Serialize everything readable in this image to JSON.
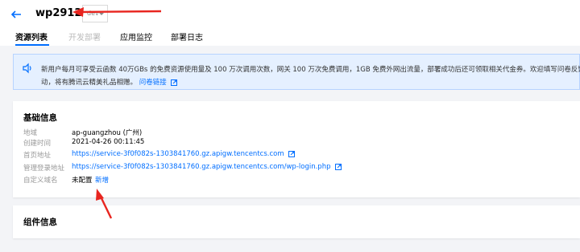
{
  "app": {
    "title": "wp29123",
    "env": "dev"
  },
  "tabs": [
    {
      "label": "资源列表",
      "state": "active"
    },
    {
      "label": "开发部署",
      "state": "disabled"
    },
    {
      "label": "应用监控",
      "state": "normal"
    },
    {
      "label": "部署日志",
      "state": "normal"
    }
  ],
  "notice": {
    "line1": "新用户每月可享受云函数 40万GBs 的免费资源使用量及 100 万次调用次数，网关 100 万次免费调用，1GB 免费外网出流量，部署成功后还可领取相关代金券。欢迎填写问卷反馈，并进入 QQ 讨",
    "line2": "动，将有腾讯云精美礼品相赠。",
    "link": "问卷链接"
  },
  "basic_info": {
    "title": "基础信息",
    "rows": [
      {
        "label": "地域",
        "value": "ap-guangzhou (广州)"
      },
      {
        "label": "创建时间",
        "value": "2021-04-26 00:11:45"
      },
      {
        "label": "首页地址",
        "value": "https://service-3f0f082s-1303841760.gz.apigw.tencentcs.com"
      },
      {
        "label": "管理登录地址",
        "value": "https://service-3f0f082s-1303841760.gz.apigw.tencentcs.com/wp-login.php"
      },
      {
        "label": "自定义域名",
        "value": "未配置",
        "action": "新增"
      }
    ]
  },
  "component_info": {
    "title": "组件信息"
  },
  "colors": {
    "accent": "#006eff",
    "annotation": "#e8251f"
  },
  "icons": [
    "back-arrow-icon",
    "speaker-icon",
    "external-link-icon"
  ]
}
